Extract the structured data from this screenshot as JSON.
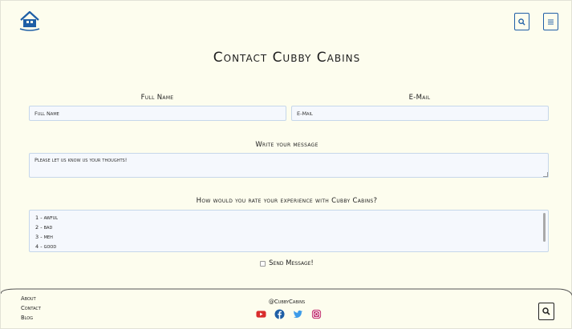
{
  "header": {
    "logo_icon": "house-icon",
    "search_icon": "search-icon",
    "menu_icon": "menu-icon"
  },
  "page": {
    "title": "Contact Cubby Cabins"
  },
  "form": {
    "full_name": {
      "label": "Full Name",
      "placeholder": "Full Name"
    },
    "email": {
      "label": "E-Mail",
      "placeholder": "E-Mail"
    },
    "message": {
      "label": "Write your message",
      "placeholder": "Please let us know us your thoughts!"
    },
    "rating": {
      "label": "How would you rate your experience with Cubby Cabins?",
      "options": [
        "1 - awful",
        "2 - bad",
        "3 - meh",
        "4 - good"
      ]
    },
    "send_label": "Send Message!"
  },
  "footer": {
    "links": {
      "about": "About",
      "contact": "Contact",
      "blog": "Blog"
    },
    "handle": "@CubbyCabins",
    "social_icons": [
      "youtube-icon",
      "facebook-icon",
      "twitter-icon",
      "instagram-icon"
    ]
  },
  "colors": {
    "background": "#fdfdee",
    "accent": "#1f5fa6",
    "field_bg": "#f5f8fd",
    "youtube": "#d92d2d",
    "facebook": "#1f5fa6",
    "twitter": "#3d9be9",
    "instagram": "#c2306f"
  }
}
